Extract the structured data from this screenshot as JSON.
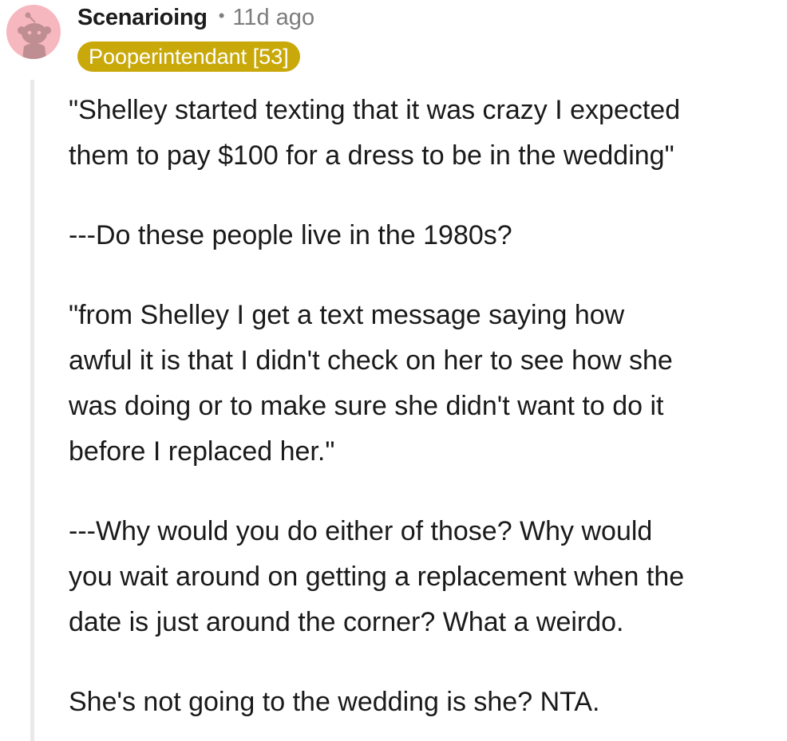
{
  "comment": {
    "username": "Scenarioing",
    "separator": "•",
    "time": "11d ago",
    "flair": "Pooperintendant [53]",
    "avatar_icon": "reddit-snoo-avatar-icon",
    "colors": {
      "avatar_bg": "#f7b7bf",
      "avatar_figure": "#bf8e93",
      "flair_bg": "#c9a90a",
      "flair_text": "#ffffff",
      "meta_text": "#7c7c7c",
      "thread_line": "#e9e9e9"
    },
    "paragraphs": [
      " \"Shelley started texting that it was crazy I expected\nthem to pay $100 for a dress to be in the wedding\"",
      "---Do these people live in the 1980s?",
      "\"from Shelley I get a text message saying how\nawful it is that I didn't check on her to see how she\nwas doing or to make sure she didn't want to do it\nbefore I replaced her.\"",
      "---Why would you do either of those? Why would\nyou wait around on getting a replacement when the\ndate is just around the corner? What a weirdo.",
      "She's not going to the wedding is she? NTA."
    ]
  }
}
